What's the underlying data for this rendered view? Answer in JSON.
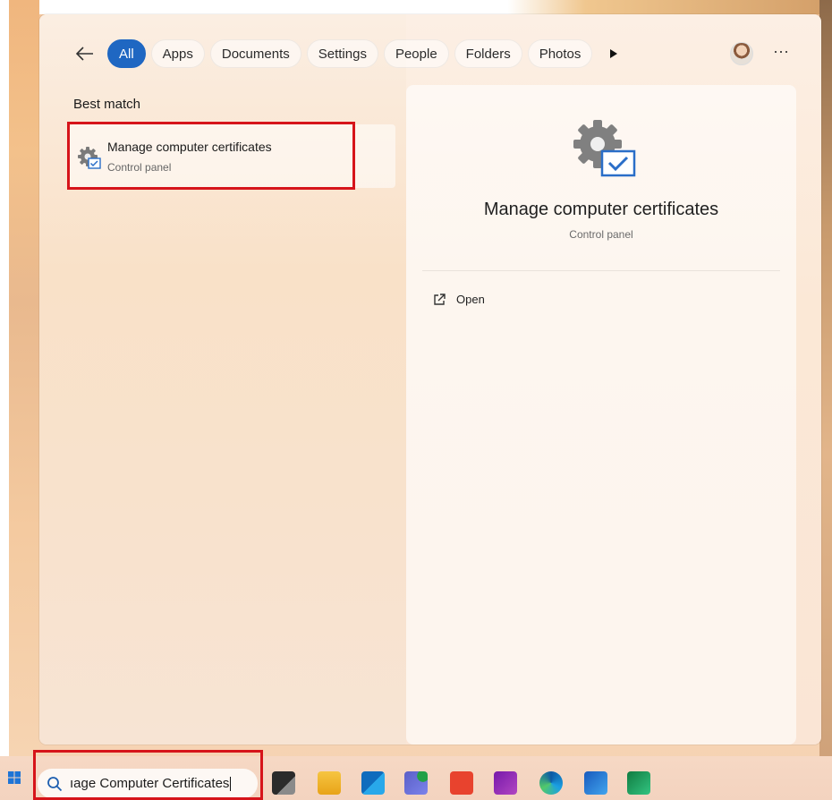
{
  "filters": {
    "tabs": [
      "All",
      "Apps",
      "Documents",
      "Settings",
      "People",
      "Folders",
      "Photos"
    ],
    "active": "All"
  },
  "best_match": {
    "label": "Best match",
    "result_title": "Manage computer certificates",
    "result_sub": "Control panel"
  },
  "preview": {
    "title": "Manage computer certificates",
    "sub": "Control panel",
    "open_label": "Open"
  },
  "taskbar": {
    "search_query": "ıage Computer Certificates",
    "apps": [
      "task-view-icon",
      "file-explorer-icon",
      "outlook-icon",
      "teams-icon",
      "sogou-icon",
      "onenote-icon",
      "edge-icon",
      "word-icon",
      "excel-icon"
    ]
  },
  "colors": {
    "accent": "#1f67c2",
    "highlight": "#d6141a"
  }
}
